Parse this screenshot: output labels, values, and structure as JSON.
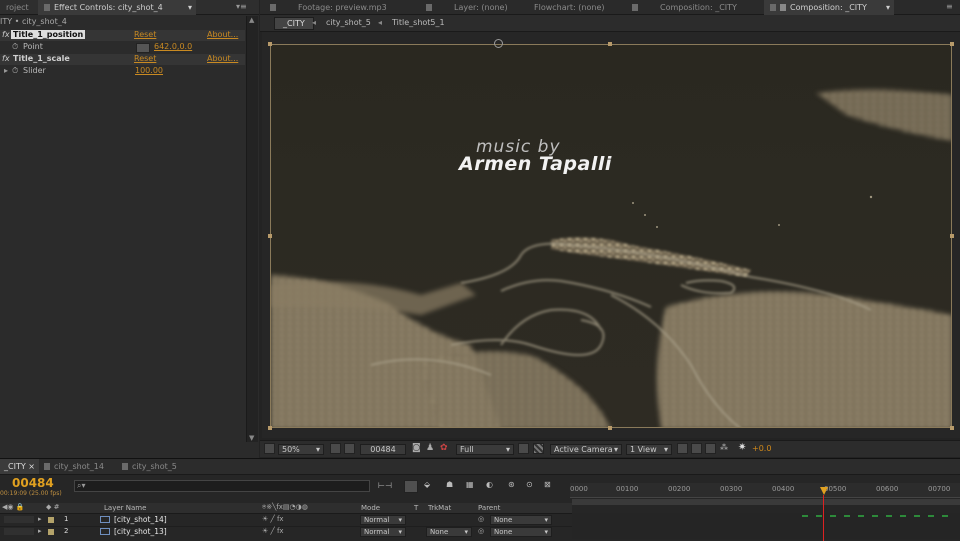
{
  "effect_panel": {
    "tab_project": "roject",
    "tab_effect_controls": "Effect Controls: city_shot_4",
    "breadcrumb": "ITY • city_shot_4",
    "effects": [
      {
        "name": "Title_1_position",
        "reset": "Reset",
        "about": "About...",
        "param": "Point",
        "value": "642.0,0.0"
      },
      {
        "name": "Title_1_scale",
        "reset": "Reset",
        "about": "About...",
        "param": "Slider",
        "value": "100.00"
      }
    ]
  },
  "viewer_tabs": {
    "footage": "Footage: preview.mp3",
    "layer": "Layer: (none)",
    "flowchart": "Flowchart: (none)",
    "comp_inactive": "Composition: _CITY",
    "comp_active": "Composition: _CITY"
  },
  "comp_breadcrumbs": [
    "_CITY",
    "city_shot_5",
    "Title_shot5_1"
  ],
  "viewport": {
    "line1": "music by",
    "line2": "Armen Tapalli"
  },
  "viewer_toolbar": {
    "zoom": "50%",
    "timecode": "00484",
    "resolution": "Full",
    "camera": "Active Camera",
    "views": "1 View",
    "exposure": "+0.0"
  },
  "timeline": {
    "tabs": [
      "_CITY",
      "city_shot_14",
      "city_shot_5"
    ],
    "current_frame": "00484",
    "current_time": "00:19:09 (25.00 fps)",
    "search_placeholder": "",
    "columns": {
      "layer_name": "Layer Name",
      "mode": "Mode",
      "t": "T",
      "trkmat": "TrkMat",
      "parent": "Parent"
    },
    "layers": [
      {
        "index": "1",
        "name": "[city_shot_14]",
        "mode": "Normal",
        "trkmat": "",
        "parent": "None"
      },
      {
        "index": "2",
        "name": "[city_shot_13]",
        "mode": "Normal",
        "trkmat": "None",
        "parent": "None"
      }
    ],
    "ruler": [
      "0000",
      "00100",
      "00200",
      "00300",
      "00400",
      "00500",
      "00600",
      "00700"
    ],
    "colors": {
      "accent": "#e0a020",
      "playhead": "#e0a020"
    }
  }
}
